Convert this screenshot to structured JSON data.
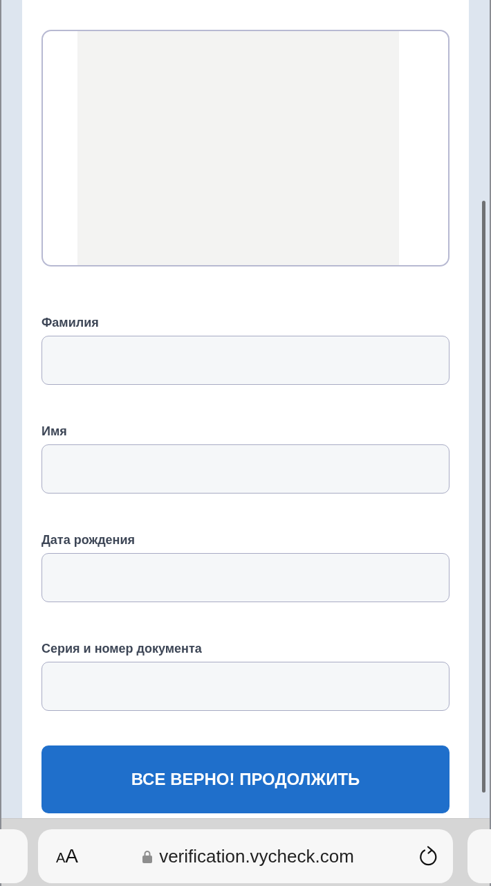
{
  "fields": [
    {
      "label": "Фамилия"
    },
    {
      "label": "Имя"
    },
    {
      "label": "Дата рождения"
    },
    {
      "label": "Серия и номер документа"
    }
  ],
  "submit_button": "ВСЕ ВЕРНО! ПРОДОЛЖИТЬ",
  "browser_bar": {
    "text_size": "AA",
    "url": "verification.vycheck.com",
    "secure": true
  }
}
